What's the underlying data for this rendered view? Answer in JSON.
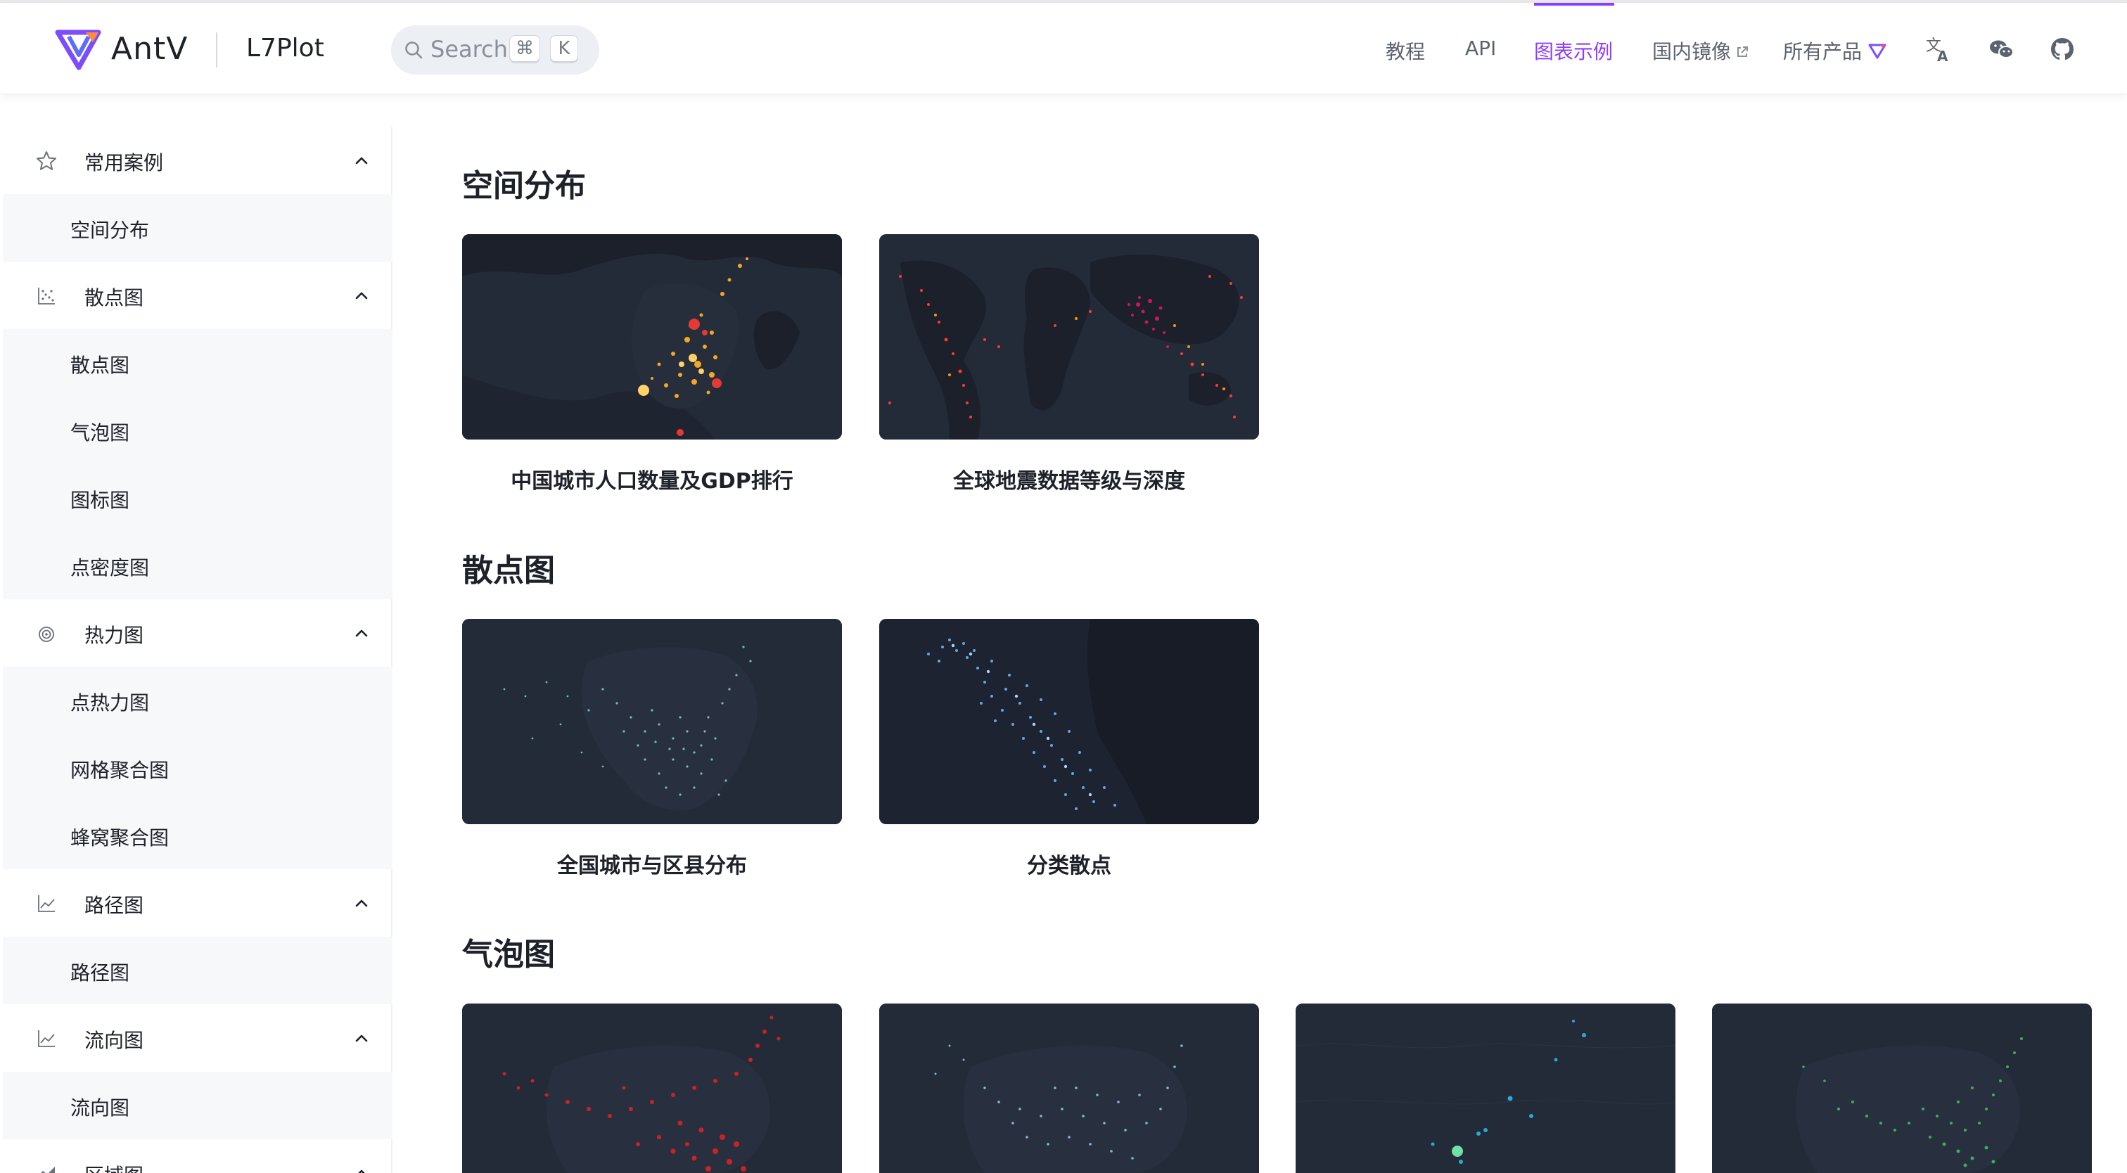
{
  "header": {
    "brand": "AntV",
    "product": "L7Plot",
    "search": {
      "placeholder": "Search",
      "shortcut_key_1": "⌘",
      "shortcut_key_2": "K"
    },
    "nav": [
      {
        "label": "教程"
      },
      {
        "label": "API"
      },
      {
        "label": "图表示例",
        "active": true
      },
      {
        "label": "国内镜像"
      },
      {
        "label": "所有产品"
      }
    ],
    "icons": [
      "translate-icon",
      "wechat-icon",
      "github-icon"
    ],
    "accent_color": "#8b3dff"
  },
  "sidebar": {
    "groups": [
      {
        "label": "常用案例",
        "icon": "star-icon",
        "items": [
          {
            "label": "空间分布"
          }
        ]
      },
      {
        "label": "散点图",
        "icon": "scatter-icon",
        "items": [
          {
            "label": "散点图"
          },
          {
            "label": "气泡图"
          },
          {
            "label": "图标图"
          },
          {
            "label": "点密度图"
          }
        ]
      },
      {
        "label": "热力图",
        "icon": "heatmap-icon",
        "items": [
          {
            "label": "点热力图"
          },
          {
            "label": "网格聚合图"
          },
          {
            "label": "蜂窝聚合图"
          }
        ]
      },
      {
        "label": "路径图",
        "icon": "line-chart-icon",
        "items": [
          {
            "label": "路径图"
          }
        ]
      },
      {
        "label": "流向图",
        "icon": "line-chart-icon",
        "items": [
          {
            "label": "流向图"
          }
        ]
      },
      {
        "label": "区域图",
        "icon": "area-chart-icon",
        "items": []
      }
    ]
  },
  "main": {
    "sections": [
      {
        "title": "空间分布",
        "cards": [
          {
            "label": "中国城市人口数量及GDP排行"
          },
          {
            "label": "全球地震数据等级与深度"
          }
        ]
      },
      {
        "title": "散点图",
        "cards": [
          {
            "label": "全国城市与区县分布"
          },
          {
            "label": "分类散点"
          }
        ]
      },
      {
        "title": "气泡图",
        "cards": [
          {
            "label": ""
          },
          {
            "label": ""
          },
          {
            "label": ""
          },
          {
            "label": ""
          }
        ]
      }
    ]
  }
}
